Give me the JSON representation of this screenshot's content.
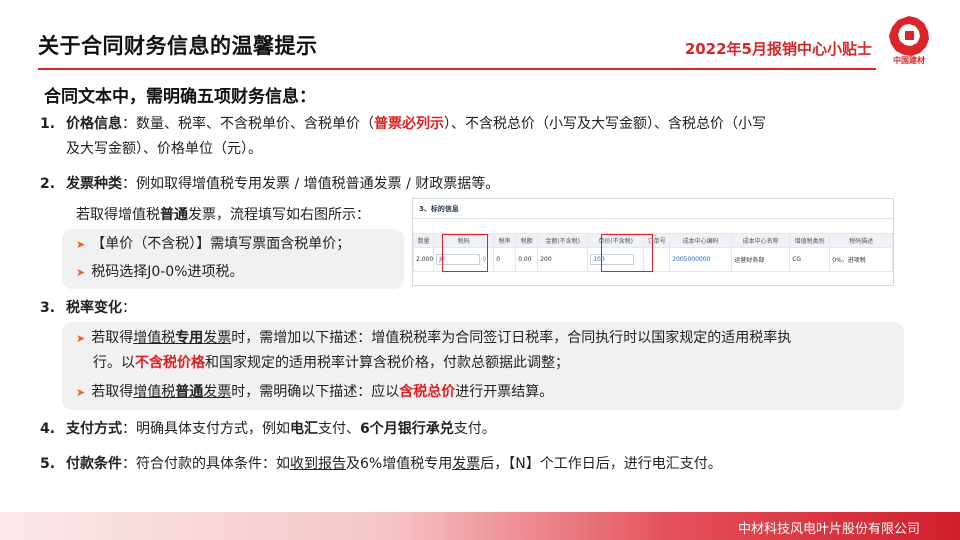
{
  "header": {
    "title": "关于合同财务信息的温馨提示",
    "tip": "2022年5月报销中心小贴士",
    "logo_text": "中国建材",
    "accent_color": "#d8262b"
  },
  "subtitle": "合同文本中，需明确五项财务信息：",
  "item1": {
    "num": "1.",
    "label": "价格信息",
    "text_a": "：数量、税率、不含税单价、含税单价（",
    "highlight": "普票必列示",
    "text_b": "）、不含税总价（小写及大写金额）、含税总价（小写",
    "line2": "及大写金额）、价格单位（元）。"
  },
  "item2": {
    "num": "2.",
    "label": "发票种类",
    "text": "：例如取得增值税专用发票 / 增值税普通发票 / 财政票据等。",
    "hint_a": "若取得增值税",
    "hint_bold": "普通",
    "hint_b": "发票，流程填写如右图所示：",
    "bullet1": "【单价（不含税）】需填写票面含税单价；",
    "bullet2": "税码选择J0-0%进项税。"
  },
  "invoice": {
    "section_title": "3、标的信息",
    "columns": [
      "数量",
      "税码",
      "税率",
      "税额",
      "金额(不含税)",
      "单价(不含税)",
      "订单号",
      "成本中心编码",
      "成本中心名称",
      "增值税类别",
      "税码描述"
    ],
    "row": [
      "2.000",
      "J0",
      "0",
      "0.00",
      "200",
      "100",
      "",
      "2005000000",
      "运营财务部",
      "CG",
      "0%，进项税"
    ]
  },
  "item3": {
    "num": "3.",
    "label": "税率变化",
    "colon": "：",
    "b1_a": "若取得",
    "b1_u1": "增值税",
    "b1_bold": "专用",
    "b1_u2": "发票",
    "b1_b": "时，需增加以下描述：增值税税率为合同签订日税率，合同执行时以国家规定的适用税率执",
    "b1_line2_a": "行。以",
    "b1_red": "不含税价格",
    "b1_line2_b": "和国家规定的适用税率计算含税价格，付款总额据此调整；",
    "b2_a": "若取得",
    "b2_u1": "增值税",
    "b2_bold": "普通",
    "b2_u2": "发票",
    "b2_b": "时，需明确以下描述：应以",
    "b2_red": "含税总价",
    "b2_c": "进行开票结算。"
  },
  "item4": {
    "num": "4.",
    "label": "支付方式",
    "text_a": "：明确具体支付方式，例如",
    "bold1": "电汇",
    "text_b": "支付、",
    "bold2": "6个月银行承兑",
    "text_c": "支付。"
  },
  "item5": {
    "num": "5.",
    "label": "付款条件",
    "text_a": "：符合付款的具体条件：如",
    "u1": "收到报告",
    "text_b": "及6%增值税专用",
    "u2": "发票",
    "text_c": "后，【N】个工作日后，进行电汇支付。"
  },
  "footer": {
    "company": "中材科技风电叶片股份有限公司"
  }
}
